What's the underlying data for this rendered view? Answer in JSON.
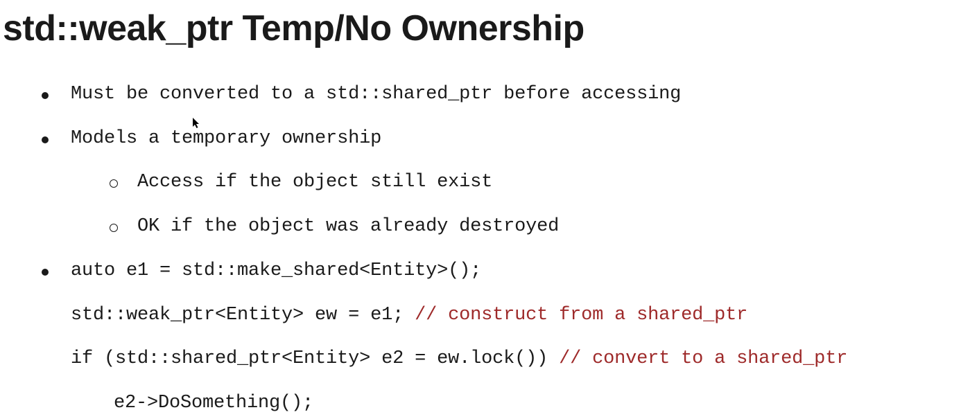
{
  "title": "std::weak_ptr Temp/No Ownership",
  "bullets": {
    "b1": "Must be converted to a std::shared_ptr before accessing",
    "b2": "Models a temporary ownership",
    "b2a": "Access if the object still exist",
    "b2b": "OK if the object was already destroyed",
    "b3_code1": "auto e1 = std::make_shared<Entity>();",
    "b3_code2_pre": "std::weak_ptr<Entity> ew = e1; ",
    "b3_code2_comment": "// construct from a shared_ptr",
    "b3_code3_pre": "if (std::shared_ptr<Entity> e2 = ew.lock()) ",
    "b3_code3_comment": "// convert to a shared_ptr",
    "b3_code4": "e2->DoSomething();"
  },
  "cursor_glyph": "▴"
}
